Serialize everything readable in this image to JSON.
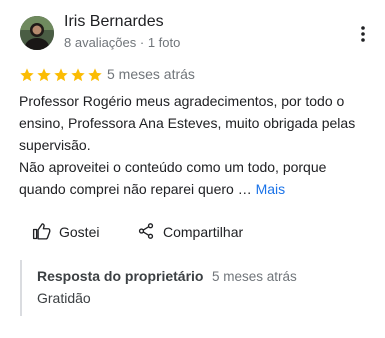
{
  "review": {
    "author": {
      "name": "Iris Bernardes",
      "meta": "8 avaliações · 1 foto"
    },
    "rating": 5,
    "star_color": "#fbbc04",
    "date": "5 meses atrás",
    "text_lines": [
      "Professor Rogério meus agradecimentos, por todo o",
      "ensino, Professora Ana Esteves, muito obrigada pelas",
      "supervisão.",
      "Não aproveitei o conteúdo como um todo, porque",
      "quando comprei não reparei quero … "
    ],
    "more_label": "Mais",
    "more_color": "#1a73e8"
  },
  "actions": {
    "like_label": "Gostei",
    "share_label": "Compartilhar"
  },
  "owner_response": {
    "title": "Resposta do proprietário",
    "date": "5 meses atrás",
    "text": "Gratidão"
  }
}
